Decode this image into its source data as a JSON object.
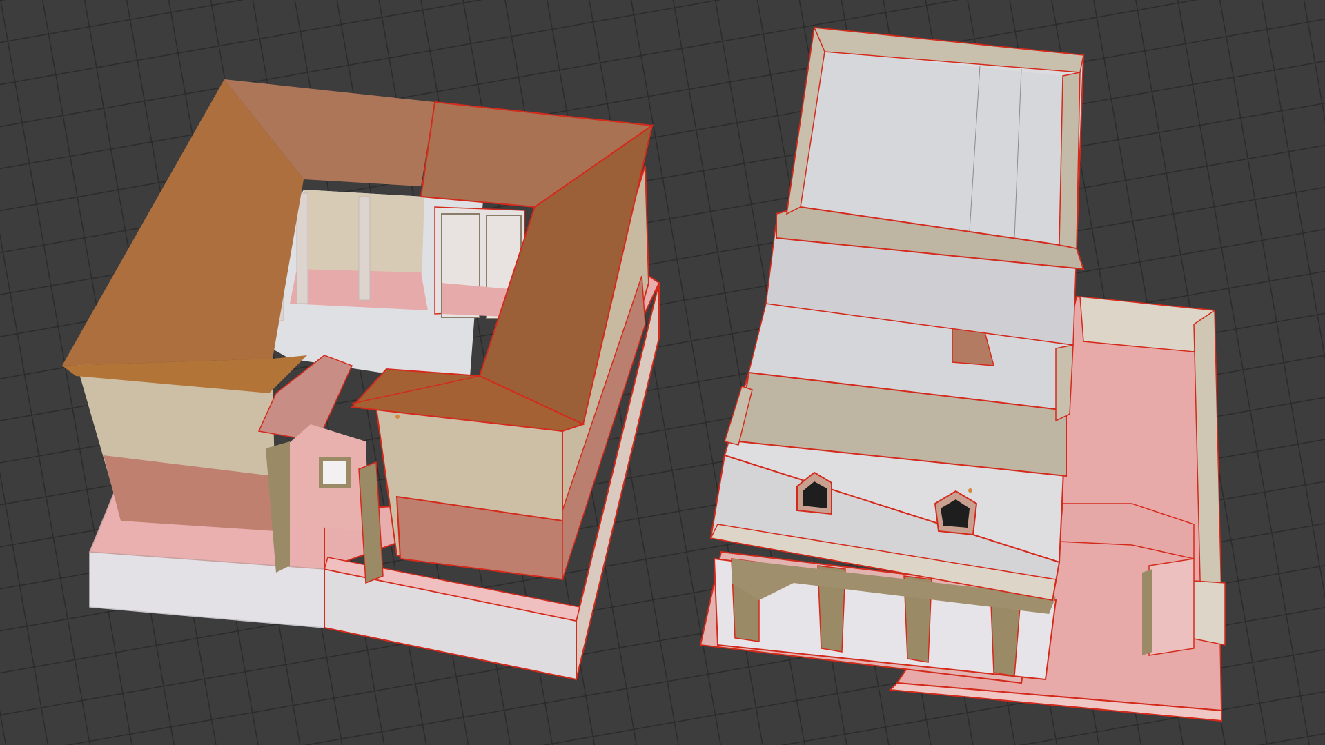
{
  "viewport": {
    "background": "#3d3d3d",
    "grid_color": "#2b2b2b",
    "selection_outline": "#d42a1c"
  },
  "scene": {
    "left_building": {
      "roof": "#b07a52",
      "wall_cream": "#cdbfa6",
      "wall_terracotta": "#c0806f",
      "courtyard_floor": "#dfe0e4",
      "pink_floor": "#e7aaa9",
      "column": "#ddd4d0",
      "door_olive": "#9a8a66"
    },
    "right_building": {
      "floor_gray": "#d5d6da",
      "parapet": "#bfb5a3",
      "wall_light": "#dedde0",
      "arcade_pier": "#9a8a66",
      "pink_terrace": "#e7aaa9",
      "chimney": "#b37c62"
    }
  }
}
